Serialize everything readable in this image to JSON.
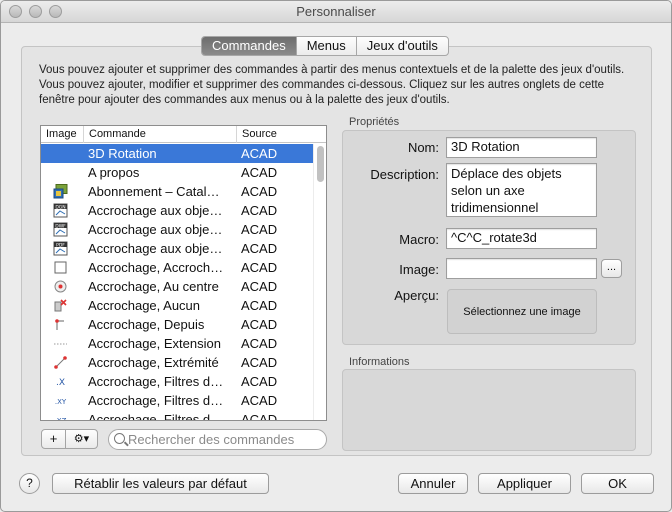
{
  "window": {
    "title": "Personnaliser"
  },
  "tabs": [
    {
      "label": "Commandes"
    },
    {
      "label": "Menus"
    },
    {
      "label": "Jeux d'outils"
    }
  ],
  "description": "Vous pouvez ajouter et supprimer des commandes à partir des menus contextuels et de la palette des jeux d'outils. Vous pouvez ajouter, modifier et supprimer des commandes ci-dessous. Cliquez sur les autres onglets de cette fenêtre pour ajouter des commandes aux menus ou à la palette des jeux d'outils.",
  "list": {
    "headers": {
      "image": "Image",
      "command": "Commande",
      "source": "Source"
    },
    "rows": [
      {
        "command": "3D Rotation",
        "source": "ACAD",
        "icon": "none"
      },
      {
        "command": "A propos",
        "source": "ACAD",
        "icon": "none"
      },
      {
        "command": "Abonnement – Catal…",
        "source": "ACAD",
        "icon": "subscription-icon"
      },
      {
        "command": "Accrochage aux obje…",
        "source": "ACAD",
        "icon": "dgn-icon"
      },
      {
        "command": "Accrochage aux obje…",
        "source": "ACAD",
        "icon": "dwf-icon"
      },
      {
        "command": "Accrochage aux obje…",
        "source": "ACAD",
        "icon": "pdf-icon"
      },
      {
        "command": "Accrochage, Accroch…",
        "source": "ACAD",
        "icon": "blank-square-icon"
      },
      {
        "command": "Accrochage, Au centre",
        "source": "ACAD",
        "icon": "center-snap-icon"
      },
      {
        "command": "Accrochage, Aucun",
        "source": "ACAD",
        "icon": "no-snap-icon"
      },
      {
        "command": "Accrochage, Depuis",
        "source": "ACAD",
        "icon": "from-snap-icon"
      },
      {
        "command": "Accrochage, Extension",
        "source": "ACAD",
        "icon": "extension-snap-icon"
      },
      {
        "command": "Accrochage, Extrémité",
        "source": "ACAD",
        "icon": "endpoint-snap-icon"
      },
      {
        "command": "Accrochage, Filtres d…",
        "source": "ACAD",
        "icon": "x-filter-icon",
        "glyph": ".X"
      },
      {
        "command": "Accrochage, Filtres d…",
        "source": "ACAD",
        "icon": "xy-filter-icon",
        "glyph": ".XY"
      },
      {
        "command": "Accrochage, Filtres d…",
        "source": "ACAD",
        "icon": "xz-filter-icon",
        "glyph": ".XZ"
      }
    ]
  },
  "toolbar": {
    "add": "+",
    "gear": "⚙▾"
  },
  "search": {
    "placeholder": "Rechercher des commandes"
  },
  "properties": {
    "section": "Propriétés",
    "name_label": "Nom:",
    "name_value": "3D Rotation",
    "desc_label": "Description:",
    "desc_value": "Déplace des objets selon un axe tridimensionnel",
    "macro_label": "Macro:",
    "macro_value": "^C^C_rotate3d",
    "image_label": "Image:",
    "image_value": "",
    "browse": "...",
    "preview_label": "Aperçu:",
    "preview_text": "Sélectionnez une image"
  },
  "info": {
    "section": "Informations"
  },
  "footer": {
    "help": "?",
    "reset": "Rétablir les valeurs par défaut",
    "cancel": "Annuler",
    "apply": "Appliquer",
    "ok": "OK"
  },
  "colors": {
    "selection": "#3a78d8",
    "tab_active": "#7a7a7a"
  }
}
